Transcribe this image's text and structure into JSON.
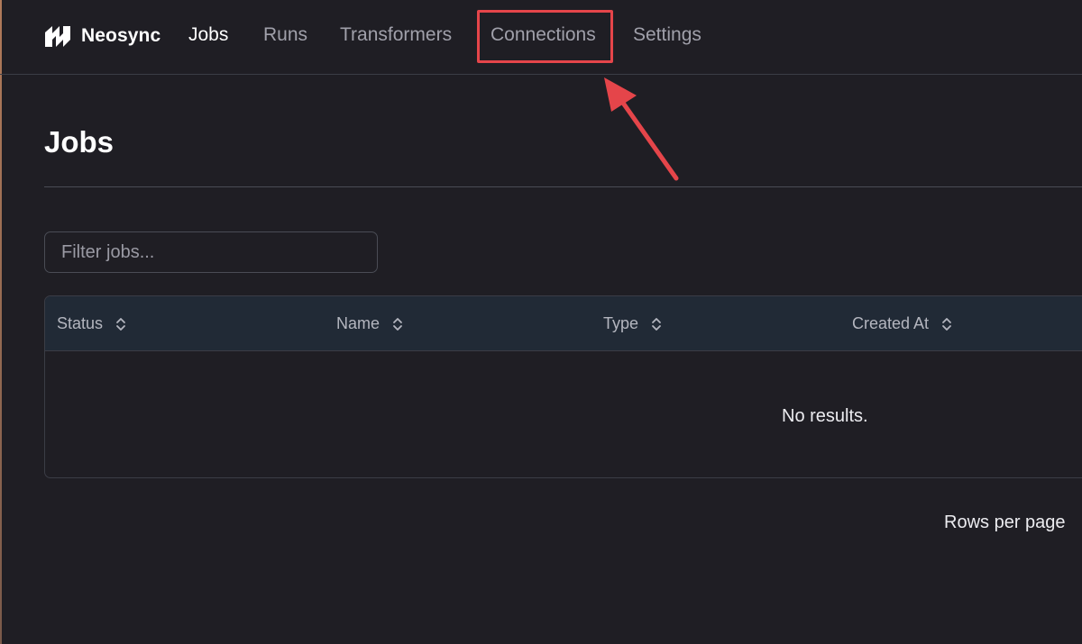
{
  "header": {
    "brand": "Neosync",
    "nav": [
      {
        "label": "Jobs",
        "active": true
      },
      {
        "label": "Runs",
        "active": false
      },
      {
        "label": "Transformers",
        "active": false
      },
      {
        "label": "Connections",
        "active": false
      },
      {
        "label": "Settings",
        "active": false
      }
    ]
  },
  "page": {
    "title": "Jobs"
  },
  "filter": {
    "placeholder": "Filter jobs...",
    "value": ""
  },
  "table": {
    "columns": [
      "Status",
      "Name",
      "Type",
      "Created At"
    ],
    "empty_message": "No results."
  },
  "pagination": {
    "rows_per_page_label": "Rows per page"
  },
  "annotation": {
    "highlight_color": "#e5454a",
    "highlighted_item": "Connections"
  },
  "colors": {
    "background": "#1f1e24",
    "table_header": "#212a36",
    "accent": "#e5454a"
  }
}
